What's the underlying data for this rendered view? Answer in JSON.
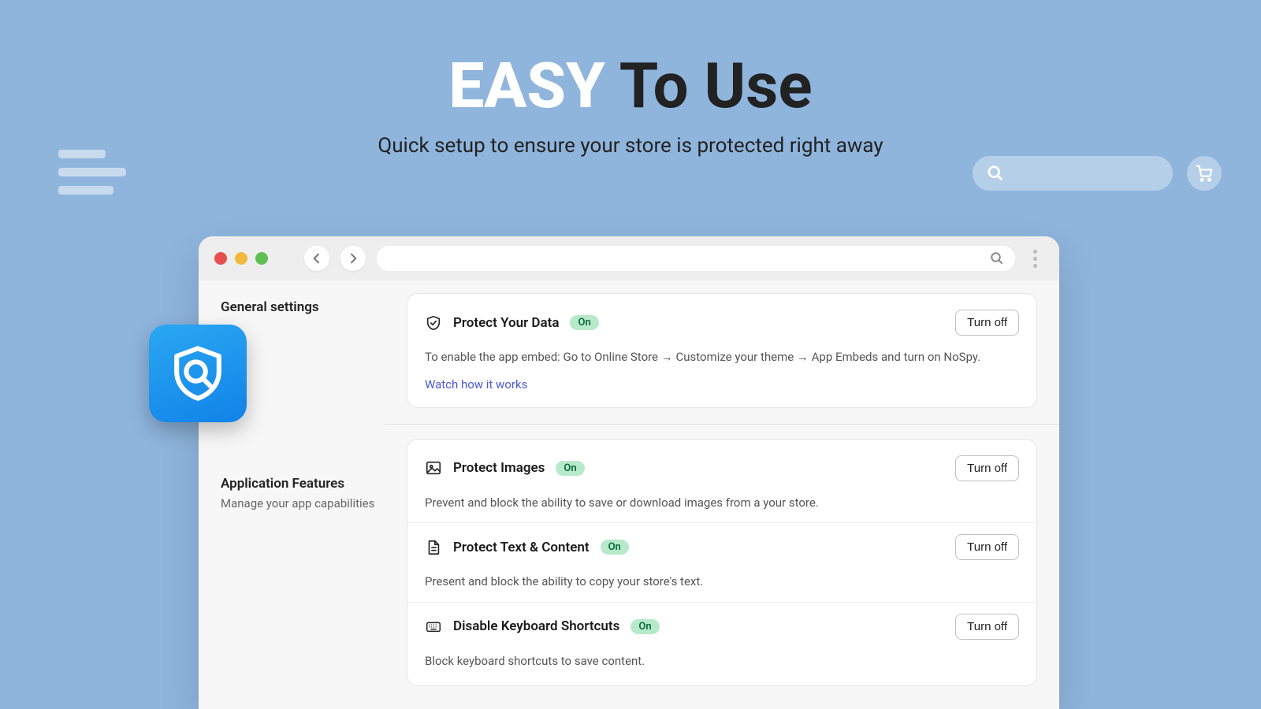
{
  "hero": {
    "title_highlight": "EASY",
    "title_rest": " To Use",
    "subtitle": "Quick setup to ensure your store is protected right away"
  },
  "window": {
    "sidebar": {
      "general_title": "General settings",
      "features_title": "Application Features",
      "features_sub": "Manage your app capabilities"
    },
    "general_card": {
      "title": "Protect Your Data",
      "badge": "On",
      "button": "Turn off",
      "description": "To enable the app embed: Go to Online Store → Customize your theme → App Embeds and turn on NoSpy.",
      "link": "Watch how it works"
    },
    "features": [
      {
        "title": "Protect Images",
        "badge": "On",
        "button": "Turn off",
        "description": "Prevent and block the ability to save or download images from a your store."
      },
      {
        "title": "Protect Text & Content",
        "badge": "On",
        "button": "Turn off",
        "description": "Present and block the ability to copy your store's text."
      },
      {
        "title": "Disable Keyboard Shortcuts",
        "badge": "On",
        "button": "Turn off",
        "description": "Block keyboard shortcuts to save content."
      }
    ]
  }
}
